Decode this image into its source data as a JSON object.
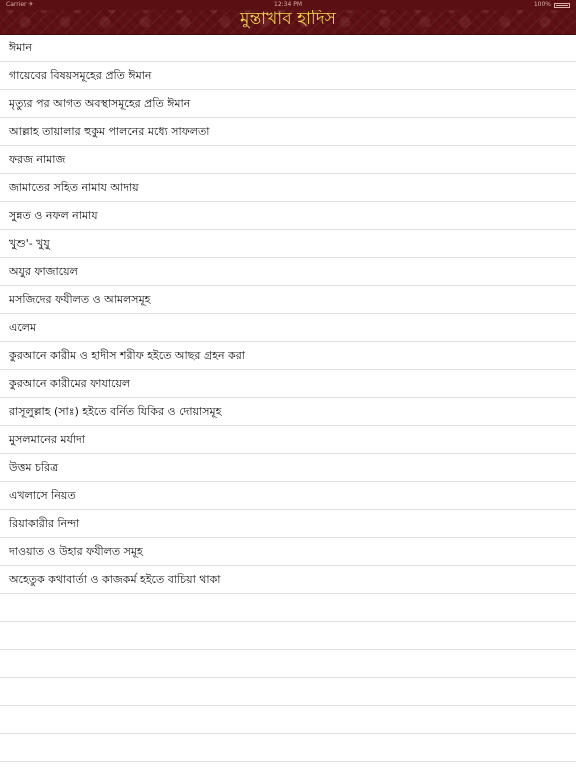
{
  "status_bar": {
    "carrier": "Carrier ✈",
    "time": "12:34 PM",
    "battery": "100%"
  },
  "nav": {
    "title": "মুন্তাখাব হাদিস"
  },
  "colors": {
    "nav_background": "#5e1014",
    "title_color": "#f4d84a"
  },
  "items": [
    {
      "label": "ঈমান"
    },
    {
      "label": "গায়েবের বিষয়সমূহের প্রতি ঈমান"
    },
    {
      "label": "মৃত্যুর পর আগত অবস্থাসমূহের প্রতি ঈমান"
    },
    {
      "label": "আল্লাহ তায়ালার হুকুম পালনের মধ্যে সাফলতা"
    },
    {
      "label": "ফরজ নামাজ"
    },
    {
      "label": "জামাতের সহিত নামায আদায়"
    },
    {
      "label": "সুন্নত ও নফল নামায"
    },
    {
      "label": "খুশু'- খুযু"
    },
    {
      "label": "অযুর ফাজায়েল"
    },
    {
      "label": "মসজিদের ফযীলত ও আমলসমূহ"
    },
    {
      "label": "এলেম"
    },
    {
      "label": "কুরআনে কারীম ও হাদীস শরীফ হইতে আছর গ্রহন করা"
    },
    {
      "label": "কুরআনে কারীমের ফাযায়েল"
    },
    {
      "label": "রাসূলুল্লাহ (সাঃ) হইতে বর্নিত যিকির ও দোয়াসমূহ"
    },
    {
      "label": "মুসলমানের মর্যাদা"
    },
    {
      "label": "উত্তম চরিত্র"
    },
    {
      "label": "এখলাসে নিয়ত"
    },
    {
      "label": "রিয়াকারীর নিন্দা"
    },
    {
      "label": "দাওয়াত ও উহার ফযীলত সমূহ"
    },
    {
      "label": "অহেতুক কথাবার্তা ও কাজকর্ম হইতে বাচিয়া থাকা"
    }
  ]
}
